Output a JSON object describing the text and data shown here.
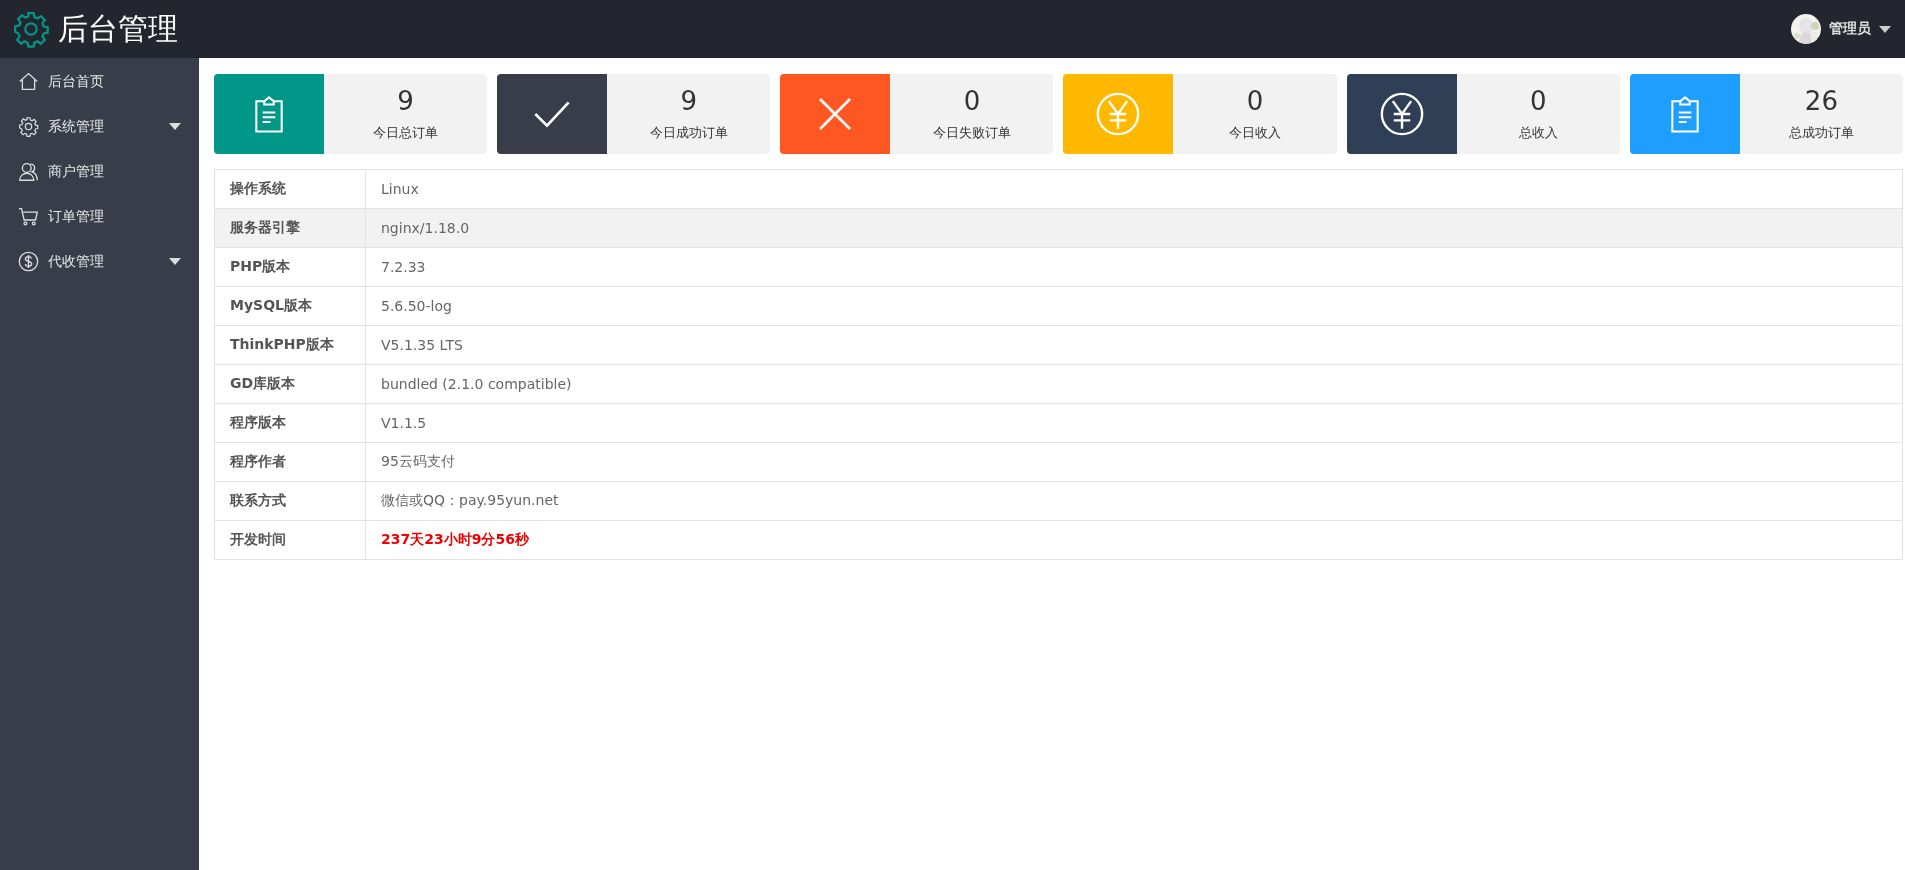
{
  "header": {
    "title": "后台管理",
    "user": {
      "name": "管理员"
    }
  },
  "sidebar": {
    "items": [
      {
        "label": "后台首页",
        "kind": "home",
        "has_submenu": false
      },
      {
        "label": "系统管理",
        "kind": "gear",
        "has_submenu": true
      },
      {
        "label": "商户管理",
        "kind": "users",
        "has_submenu": false
      },
      {
        "label": "订单管理",
        "kind": "cart",
        "has_submenu": false
      },
      {
        "label": "代收管理",
        "kind": "dollar",
        "has_submenu": true
      }
    ]
  },
  "stats": [
    {
      "value": "9",
      "label": "今日总订单",
      "kind": "clipboard",
      "color": "#009688"
    },
    {
      "value": "9",
      "label": "今日成功订单",
      "kind": "check",
      "color": "#393d49"
    },
    {
      "value": "0",
      "label": "今日失败订单",
      "kind": "cross",
      "color": "#ff5722"
    },
    {
      "value": "0",
      "label": "今日收入",
      "kind": "yen",
      "color": "#ffb800"
    },
    {
      "value": "0",
      "label": "总收入",
      "kind": "yen",
      "color": "#2f4056"
    },
    {
      "value": "26",
      "label": "总成功订单",
      "kind": "clipboard",
      "color": "#1e9fff"
    }
  ],
  "info_table": {
    "rows": [
      {
        "label": "操作系统",
        "value": "Linux",
        "highlighted": false,
        "kind": "plain"
      },
      {
        "label": "服务器引擎",
        "value": "nginx/1.18.0",
        "highlighted": true,
        "kind": "plain"
      },
      {
        "label": "PHP版本",
        "value": "7.2.33",
        "highlighted": false,
        "kind": "plain"
      },
      {
        "label": "MySQL版本",
        "value": "5.6.50-log",
        "highlighted": false,
        "kind": "plain"
      },
      {
        "label": "ThinkPHP版本",
        "value": "V5.1.35 LTS",
        "highlighted": false,
        "kind": "plain"
      },
      {
        "label": "GD库版本",
        "value": "bundled (2.1.0 compatible)",
        "highlighted": false,
        "kind": "plain"
      },
      {
        "label": "程序版本",
        "value": "V1.1.5",
        "highlighted": false,
        "kind": "plain"
      },
      {
        "label": "程序作者",
        "value": "95云码支付",
        "highlighted": false,
        "kind": "plain"
      },
      {
        "label": "联系方式",
        "value": "微信或QQ：pay.95yun.net",
        "highlighted": false,
        "kind": "plain"
      },
      {
        "label": "开发时间",
        "value": "237天23小时9分56秒",
        "highlighted": false,
        "kind": "alert"
      }
    ]
  }
}
